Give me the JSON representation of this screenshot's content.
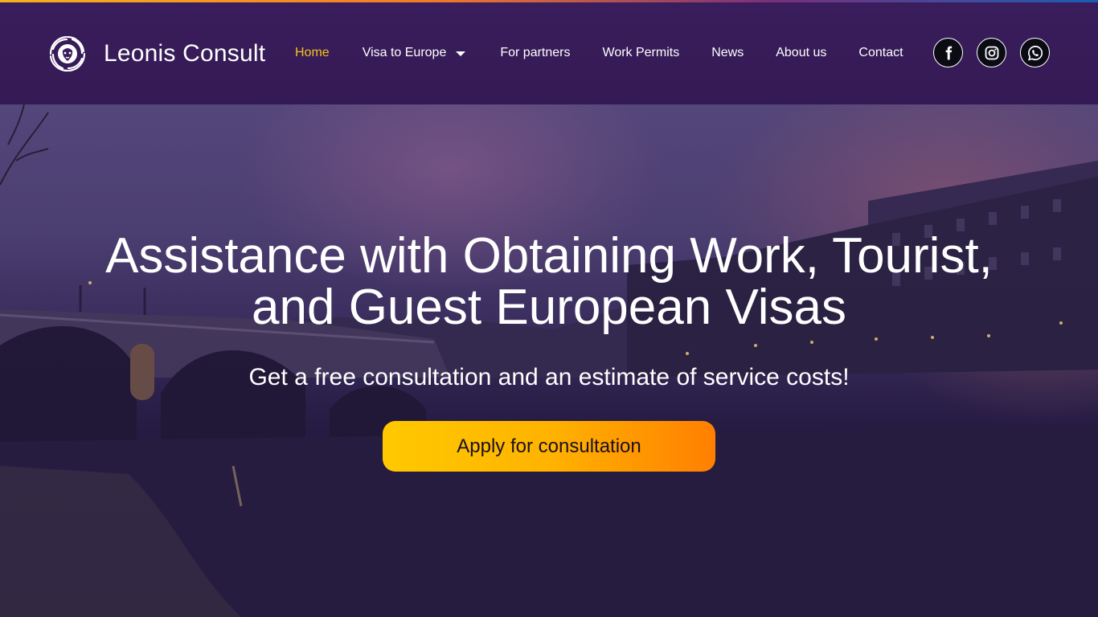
{
  "brand": {
    "name": "Leonis Consult",
    "logo_icon": "lion-swirl-logo"
  },
  "nav": {
    "items": [
      {
        "label": "Home",
        "active": true
      },
      {
        "label": "Visa to Europe",
        "has_dropdown": true
      },
      {
        "label": "For partners"
      },
      {
        "label": "Work Permits"
      },
      {
        "label": "News"
      },
      {
        "label": "About us"
      },
      {
        "label": "Contact"
      }
    ]
  },
  "socials": [
    {
      "icon": "facebook-icon"
    },
    {
      "icon": "instagram-icon"
    },
    {
      "icon": "whatsapp-icon"
    }
  ],
  "hero": {
    "headline_line1": "Assistance with Obtaining Work, Tourist,",
    "headline_line2": "and Guest European Visas",
    "subheadline": "Get a free consultation and an estimate of service costs!",
    "cta_label": "Apply for consultation"
  },
  "colors": {
    "header_bg": "#3a1d5c",
    "active_nav": "#f4c21b",
    "cta_gradient_start": "#ffc900",
    "cta_gradient_end": "#ff7f00"
  }
}
